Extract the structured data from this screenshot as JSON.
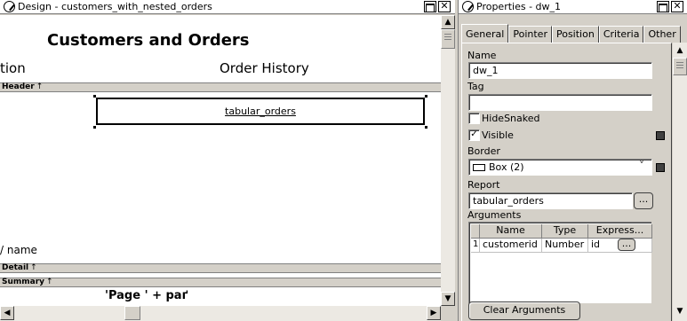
{
  "design": {
    "title": "Design - customers_with_nested_orders",
    "heading": "Customers and Orders",
    "col_partial": "tion",
    "col_order": "Order History",
    "header_band": "Header",
    "nested_report": "tabular_orders",
    "name_partial": "/ name",
    "detail_band": "Detail",
    "summary_band": "Summary",
    "page_expr": "'Page ' + paґ"
  },
  "props": {
    "title": "Properties - dw_1",
    "tabs": [
      "General",
      "Pointer",
      "Position",
      "Criteria",
      "Other"
    ],
    "name_label": "Name",
    "name_value": "dw_1",
    "tag_label": "Tag",
    "tag_value": "",
    "hidesnaked_label": "HideSnaked",
    "hidesnaked_checked": false,
    "visible_label": "Visible",
    "visible_checked": true,
    "border_label": "Border",
    "border_value": "Box (2)",
    "report_label": "Report",
    "report_value": "tabular_orders",
    "ellipsis": "...",
    "arguments_label": "Arguments",
    "grid_headers": [
      "Name",
      "Type",
      "Express..."
    ],
    "grid_rows": [
      {
        "num": "1",
        "name": "customerid",
        "type": "Number",
        "expr": "id"
      }
    ],
    "clear_button": "Clear Arguments"
  },
  "icons": {
    "close": "✕",
    "up": "▲",
    "down": "▼",
    "left": "◀",
    "right": "▶",
    "check": "✓",
    "band_arrow": "↑",
    "combo_arrow": "˅"
  }
}
